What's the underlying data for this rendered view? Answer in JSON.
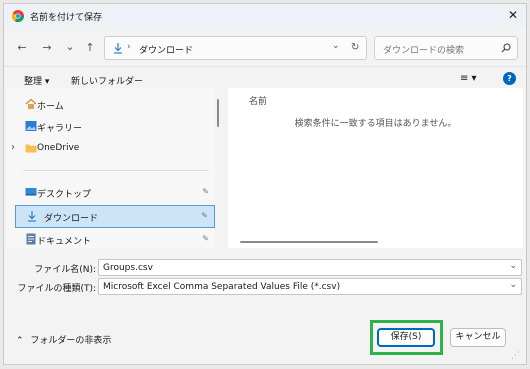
{
  "window": {
    "title": "名前を付けて保存",
    "close_glyph": "✕"
  },
  "nav": {
    "back": "←",
    "forward": "→",
    "history": "⌄",
    "up": "↑"
  },
  "address": {
    "separator": "›",
    "current": "ダウンロード",
    "dropdown": "⌄",
    "refresh": "↻"
  },
  "search": {
    "placeholder": "ダウンロードの検索",
    "icon_glyph": "⌕"
  },
  "toolbar": {
    "organize": "整理 ▾",
    "new_folder": "新しいフォルダー",
    "view": "≡ ▾",
    "help": "?"
  },
  "sidebar": {
    "items": [
      {
        "label": "ホーム",
        "icon": "home-icon"
      },
      {
        "label": "ギャラリー",
        "icon": "gallery-icon"
      },
      {
        "label": "OneDrive",
        "icon": "folder-icon"
      },
      {
        "label": "デスクトップ",
        "icon": "desktop-icon",
        "pinned": true
      },
      {
        "label": "ダウンロード",
        "icon": "download-icon",
        "pinned": true,
        "selected": true
      },
      {
        "label": "ドキュメント",
        "icon": "document-icon",
        "pinned": true
      }
    ],
    "expand_glyph": "›",
    "pin_glyph": "✎"
  },
  "content": {
    "column_name": "名前",
    "empty_message": "検索条件に一致する項目はありません。"
  },
  "form": {
    "filename_label": "ファイル名(N):",
    "filename_value": "Groups.csv",
    "filetype_label": "ファイルの種類(T):",
    "filetype_value": "Microsoft Excel Comma Separated Values File (*.csv)"
  },
  "footer": {
    "hide_folders": "フォルダーの非表示",
    "save": "保存(S)",
    "cancel": "キャンセル"
  },
  "colors": {
    "accent": "#0067c0",
    "highlight": "#2fb24a",
    "selected": "#cce4f7"
  }
}
